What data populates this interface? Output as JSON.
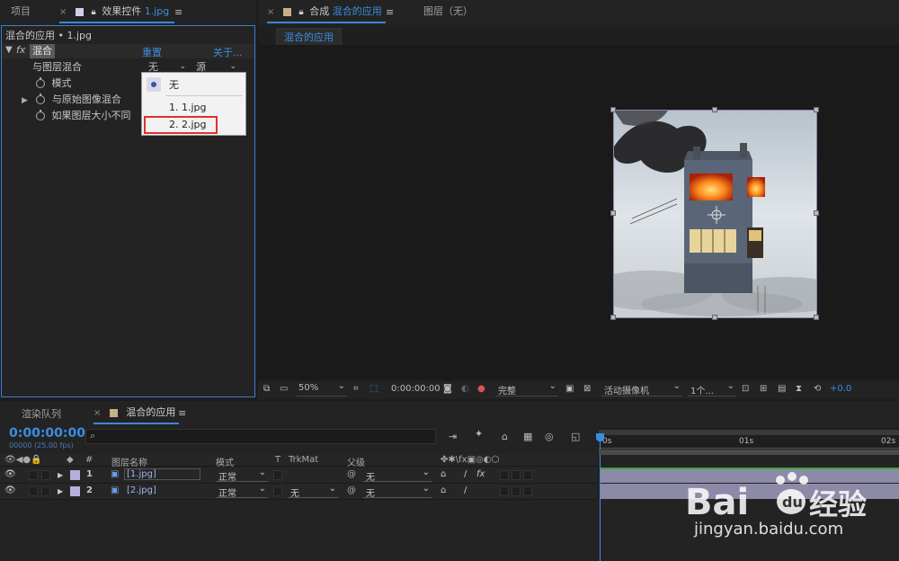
{
  "top_panel_tabs": {
    "project": "项目",
    "effect_controls_prefix": "效果控件",
    "effect_controls_file": "1.jpg",
    "comp_prefix": "合成",
    "comp_name": "混合的应用",
    "layer_tab": "图层（无）"
  },
  "effect_controls": {
    "path": "混合的应用 • 1.jpg",
    "fx_label": "fx",
    "effect_name": "混合",
    "reset": "重置",
    "about": "关于...",
    "props": [
      {
        "label": "与图层混合",
        "value": "无",
        "value2": "源"
      },
      {
        "label": "模式"
      },
      {
        "label": "与原始图像混合"
      },
      {
        "label": "如果图层大小不同"
      }
    ],
    "menu": {
      "items": [
        "无",
        "1. 1.jpg",
        "2. 2.jpg"
      ],
      "selected_index": 0,
      "highlighted_index": 2,
      "highlight_color": "#e03030"
    }
  },
  "comp_viewer": {
    "breadcrumb": "混合的应用"
  },
  "viewer_toolbar": {
    "zoom": "50%",
    "timecode": "0:00:00:00",
    "resolution": "完整",
    "camera": "活动摄像机",
    "views": "1个...",
    "exposure": "+0.0"
  },
  "timeline": {
    "tabs": {
      "render_queue": "渲染队列",
      "comp": "混合的应用"
    },
    "timecode": "0:00:00:00",
    "fps": "00000 (25.00 fps)",
    "search_placeholder": "",
    "columns": {
      "num": "#",
      "layer_name": "图层名称",
      "mode": "模式",
      "t": "T",
      "trkmat": "TrkMat",
      "parent": "父级"
    },
    "ruler": {
      "t0": "0s",
      "t1": "01s",
      "t2": "02s"
    },
    "layers": [
      {
        "num": "1",
        "name": "[1.jpg]",
        "mode": "正常",
        "trkmat": "",
        "parent": "无"
      },
      {
        "num": "2",
        "name": "[2.jpg]",
        "mode": "正常",
        "trkmat": "无",
        "parent": "无"
      }
    ],
    "accent": "#3b8de0"
  },
  "watermark": {
    "brand": "Bai du 经验",
    "url": "jingyan.baidu.com"
  }
}
